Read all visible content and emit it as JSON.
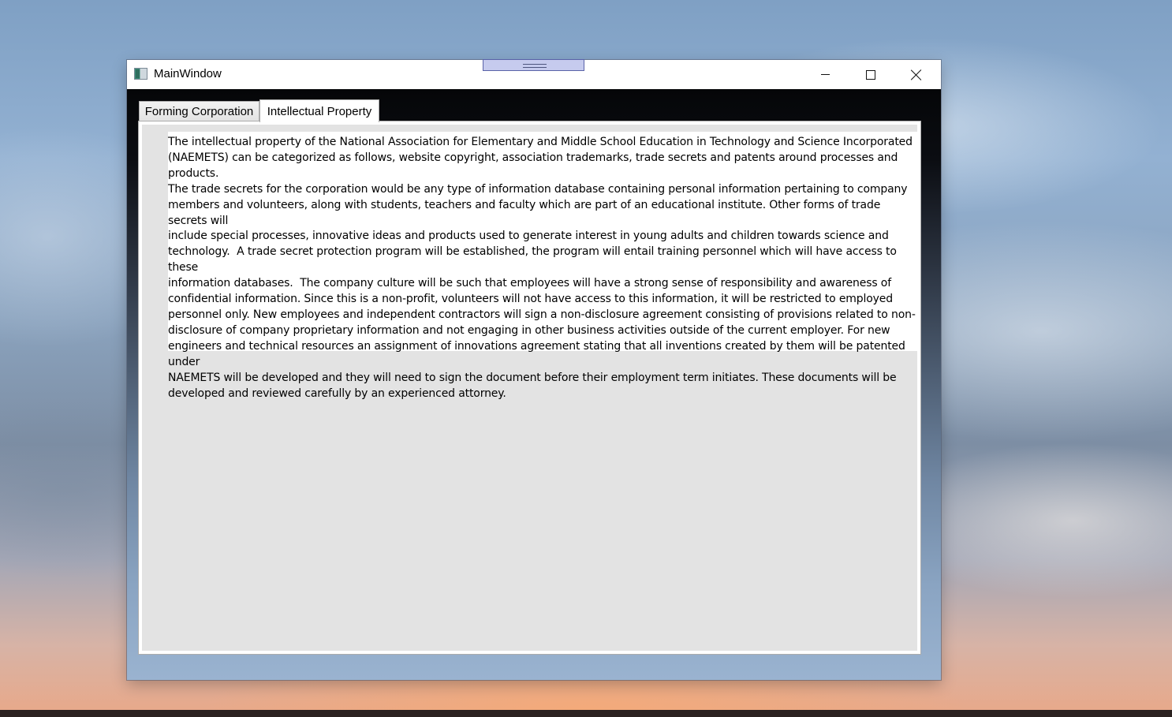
{
  "window": {
    "title": "MainWindow",
    "icon": "app-window-icon"
  },
  "tabs": [
    {
      "label": "Forming Corporation",
      "selected": false
    },
    {
      "label": "Intellectual Property",
      "selected": true
    }
  ],
  "content": {
    "lines": [
      "The intellectual property of the National Association for Elementary and Middle School Education in Technology and Science Incorporated",
      "(NAEMETS) can be categorized as follows, website copyright, association trademarks, trade secrets and patents around processes and products.",
      "The trade secrets for the corporation would be any type of information database containing personal information pertaining to company",
      "members and volunteers, along with students, teachers and faculty which are part of an educational institute. Other forms of trade secrets will",
      "include special processes, innovative ideas and products used to generate interest in young adults and children towards science and",
      "technology.  A trade secret protection program will be established, the program will entail training personnel which will have access to these",
      "information databases.  The company culture will be such that employees will have a strong sense of responsibility and awareness of",
      "confidential information. Since this is a non-profit, volunteers will not have access to this information, it will be restricted to employed",
      "personnel only. New employees and independent contractors will sign a non-disclosure agreement consisting of provisions related to non-",
      "disclosure of company proprietary information and not engaging in other business activities outside of the current employer. For new",
      "engineers and technical resources an assignment of innovations agreement stating that all inventions created by them will be patented under",
      "NAEMETS will be developed and they will need to sign the document before their employment term initiates. These documents will be",
      "developed and reviewed carefully by an experienced attorney."
    ]
  }
}
